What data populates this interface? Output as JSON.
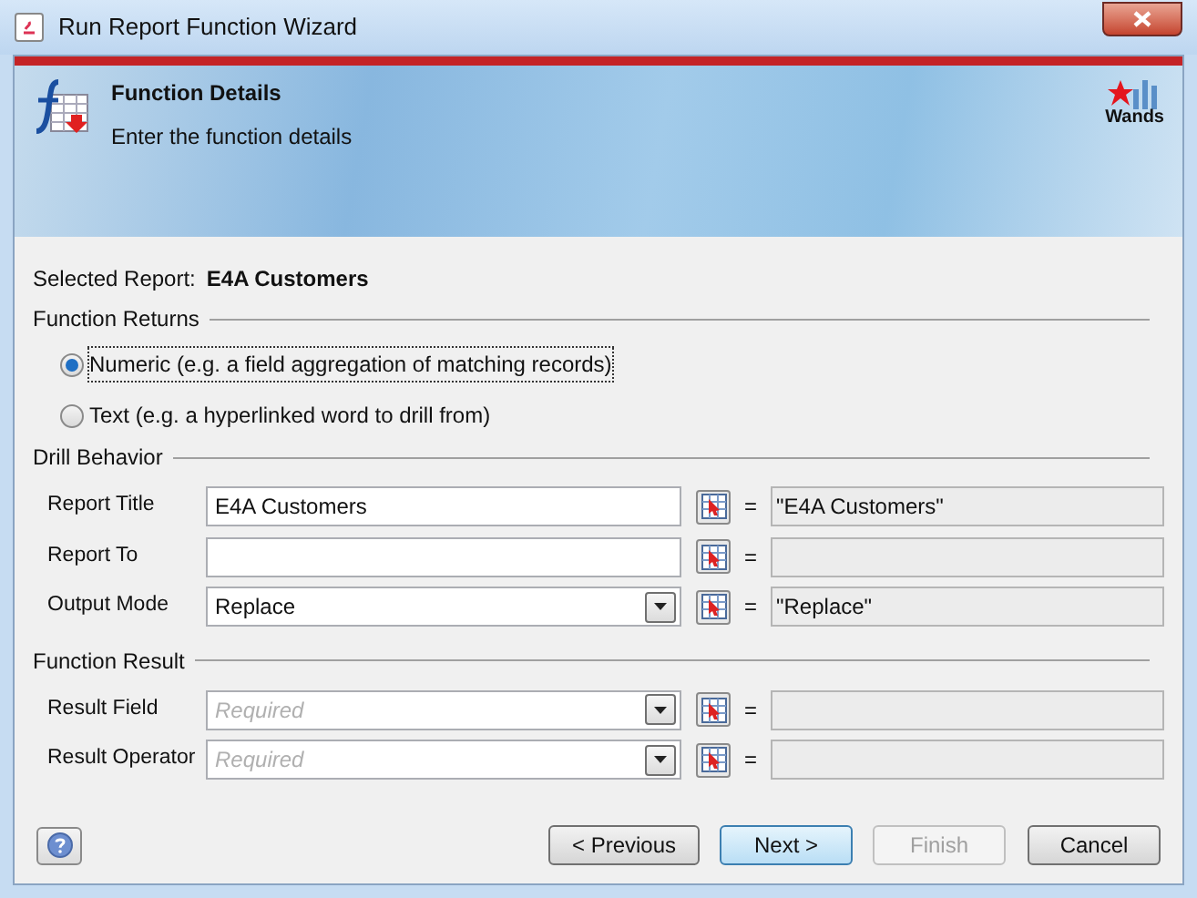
{
  "window": {
    "title": "Run Report Function Wizard"
  },
  "header": {
    "title": "Function Details",
    "subtitle": "Enter the function details",
    "logo_text": "Wands"
  },
  "selected_report": {
    "label": "Selected Report:",
    "value": "E4A Customers"
  },
  "function_returns": {
    "title": "Function Returns",
    "options": [
      {
        "label": "Numeric (e.g. a field aggregation of matching records)",
        "selected": true
      },
      {
        "label": "Text (e.g. a hyperlinked word to drill from)",
        "selected": false
      }
    ]
  },
  "sections": [
    {
      "title": "Drill Behavior",
      "rows": [
        {
          "label": "Report Title",
          "kind": "text",
          "value": "E4A Customers",
          "equals": "=",
          "expression": "\"E4A Customers\""
        },
        {
          "label": "Report To",
          "kind": "text",
          "equals": "="
        },
        {
          "label": "Output Mode",
          "kind": "combo",
          "value": "Replace",
          "equals": "=",
          "expression": "\"Replace\""
        }
      ]
    },
    {
      "title": "Function Result",
      "rows": [
        {
          "label": "Result Field",
          "kind": "combo",
          "placeholder": "Required",
          "equals": "="
        },
        {
          "label": "Result Operator",
          "kind": "combo",
          "placeholder": "Required",
          "equals": "="
        }
      ]
    }
  ],
  "buttons": [
    {
      "label": "< Previous",
      "disabled": false,
      "default": false
    },
    {
      "label": "Next >",
      "disabled": false,
      "default": true
    },
    {
      "label": "Finish",
      "disabled": true,
      "default": false
    },
    {
      "label": "Cancel",
      "disabled": false,
      "default": false
    }
  ]
}
